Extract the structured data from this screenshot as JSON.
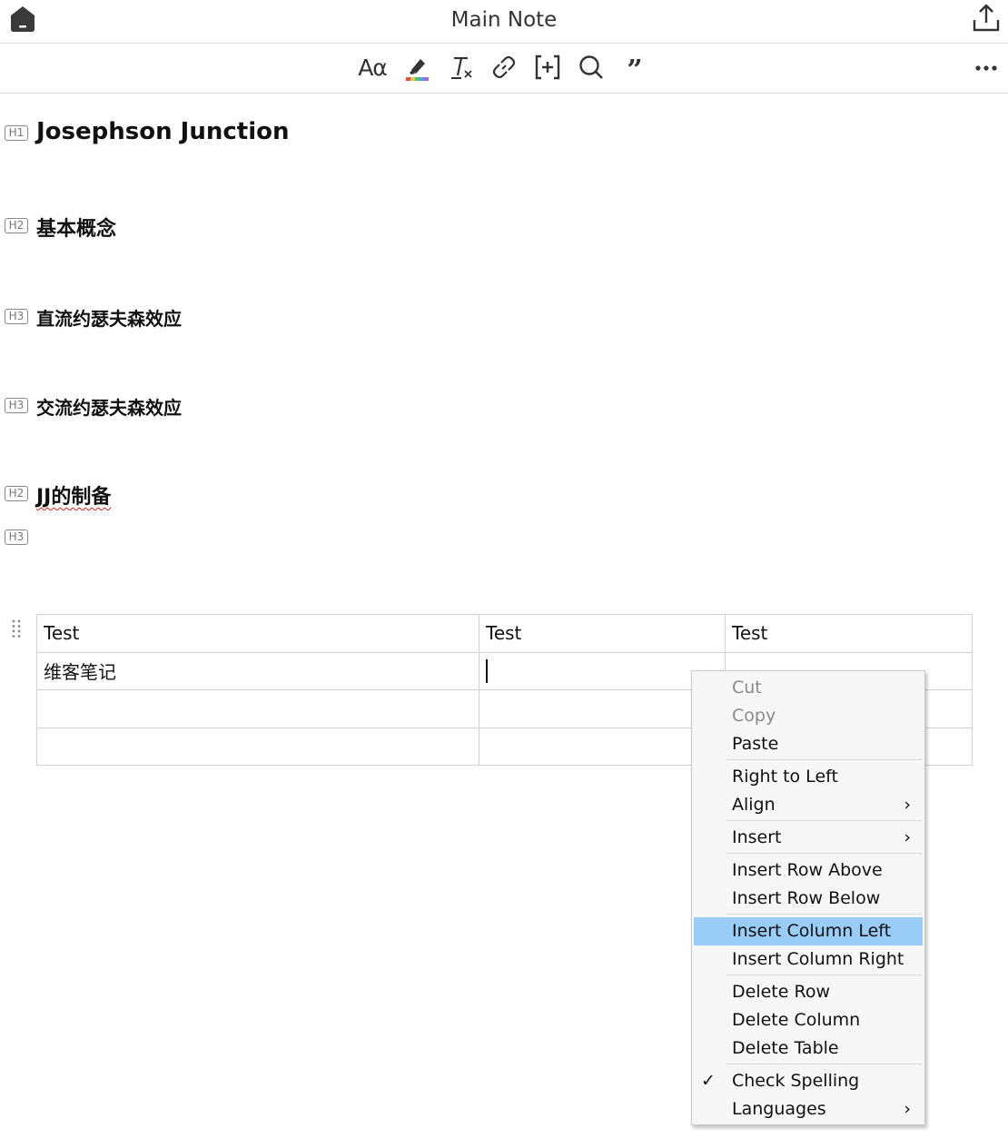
{
  "window": {
    "title": "Main Note"
  },
  "toolbar": {
    "font_label": "Aα",
    "quote_label": "”"
  },
  "headings": [
    {
      "level_badge": "H1",
      "text": "Josephson Junction"
    },
    {
      "level_badge": "H2",
      "text": "基本概念"
    },
    {
      "level_badge": "H3",
      "text": "直流约瑟夫森效应"
    },
    {
      "level_badge": "H3",
      "text": "交流约瑟夫森效应"
    },
    {
      "level_badge": "H2",
      "text": "JJ的制备"
    },
    {
      "level_badge": "H3",
      "text": ""
    }
  ],
  "table": {
    "rows": [
      [
        "Test",
        "Test",
        "Test"
      ],
      [
        "维客笔记",
        "",
        ""
      ],
      [
        "",
        "",
        ""
      ],
      [
        "",
        "",
        ""
      ]
    ]
  },
  "context_menu": {
    "cut": "Cut",
    "copy": "Copy",
    "paste": "Paste",
    "right_to_left": "Right to Left",
    "align": "Align",
    "insert": "Insert",
    "insert_row_above": "Insert Row Above",
    "insert_row_below": "Insert Row Below",
    "insert_column_left": "Insert Column Left",
    "insert_column_right": "Insert Column Right",
    "delete_row": "Delete Row",
    "delete_column": "Delete Column",
    "delete_table": "Delete Table",
    "check_spelling": "Check Spelling",
    "languages": "Languages",
    "submenu_arrow": "›",
    "check_mark": "✓"
  },
  "colors": {
    "menu_highlight": "#99ccf7",
    "spelling_underline": "#e02020"
  },
  "icons": [
    "home-icon",
    "share-icon",
    "font-icon",
    "highlighter-icon",
    "clear-format-icon",
    "link-icon",
    "insert-bracket-icon",
    "search-icon",
    "quote-icon",
    "more-icon",
    "drag-handle-icon"
  ]
}
